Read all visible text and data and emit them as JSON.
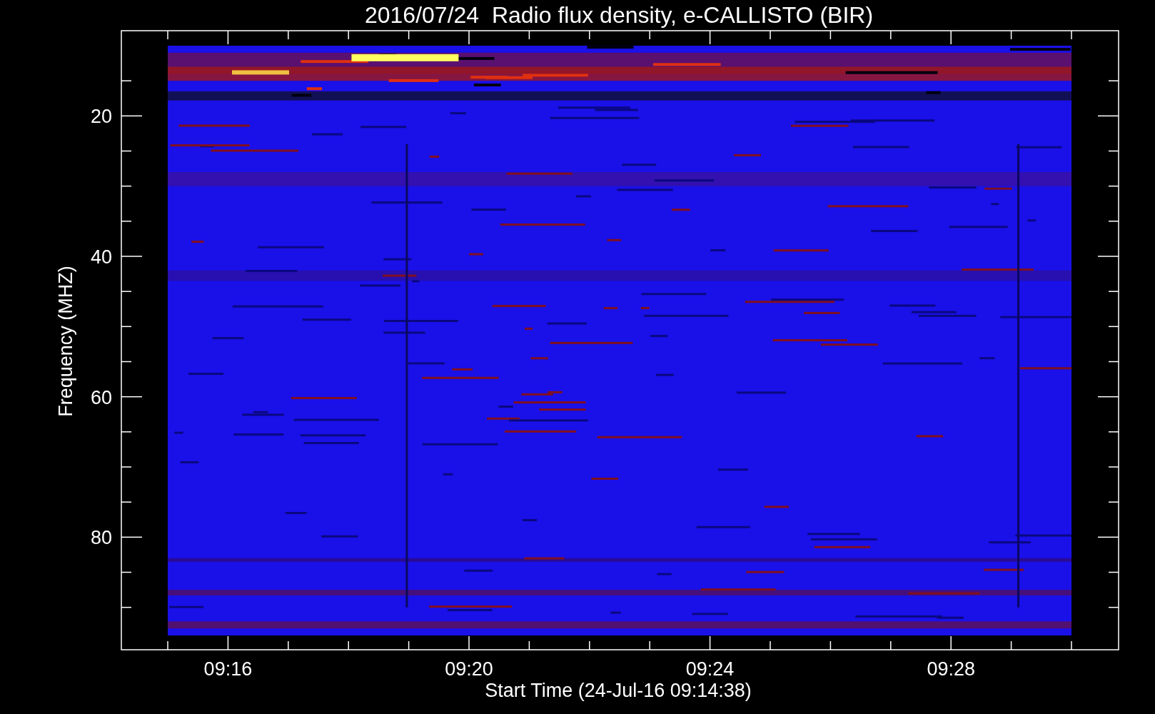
{
  "title": "2016/07/24  Radio flux density, e-CALLISTO (BIR)",
  "plot": {
    "xlabel": "Start Time (24-Jul-16 09:14:38)",
    "ylabel": "Frequency (MHZ)",
    "xticks": [
      "09:16",
      "09:20",
      "09:24",
      "09:28"
    ],
    "yticks": [
      "20",
      "40",
      "60",
      "80"
    ]
  }
}
